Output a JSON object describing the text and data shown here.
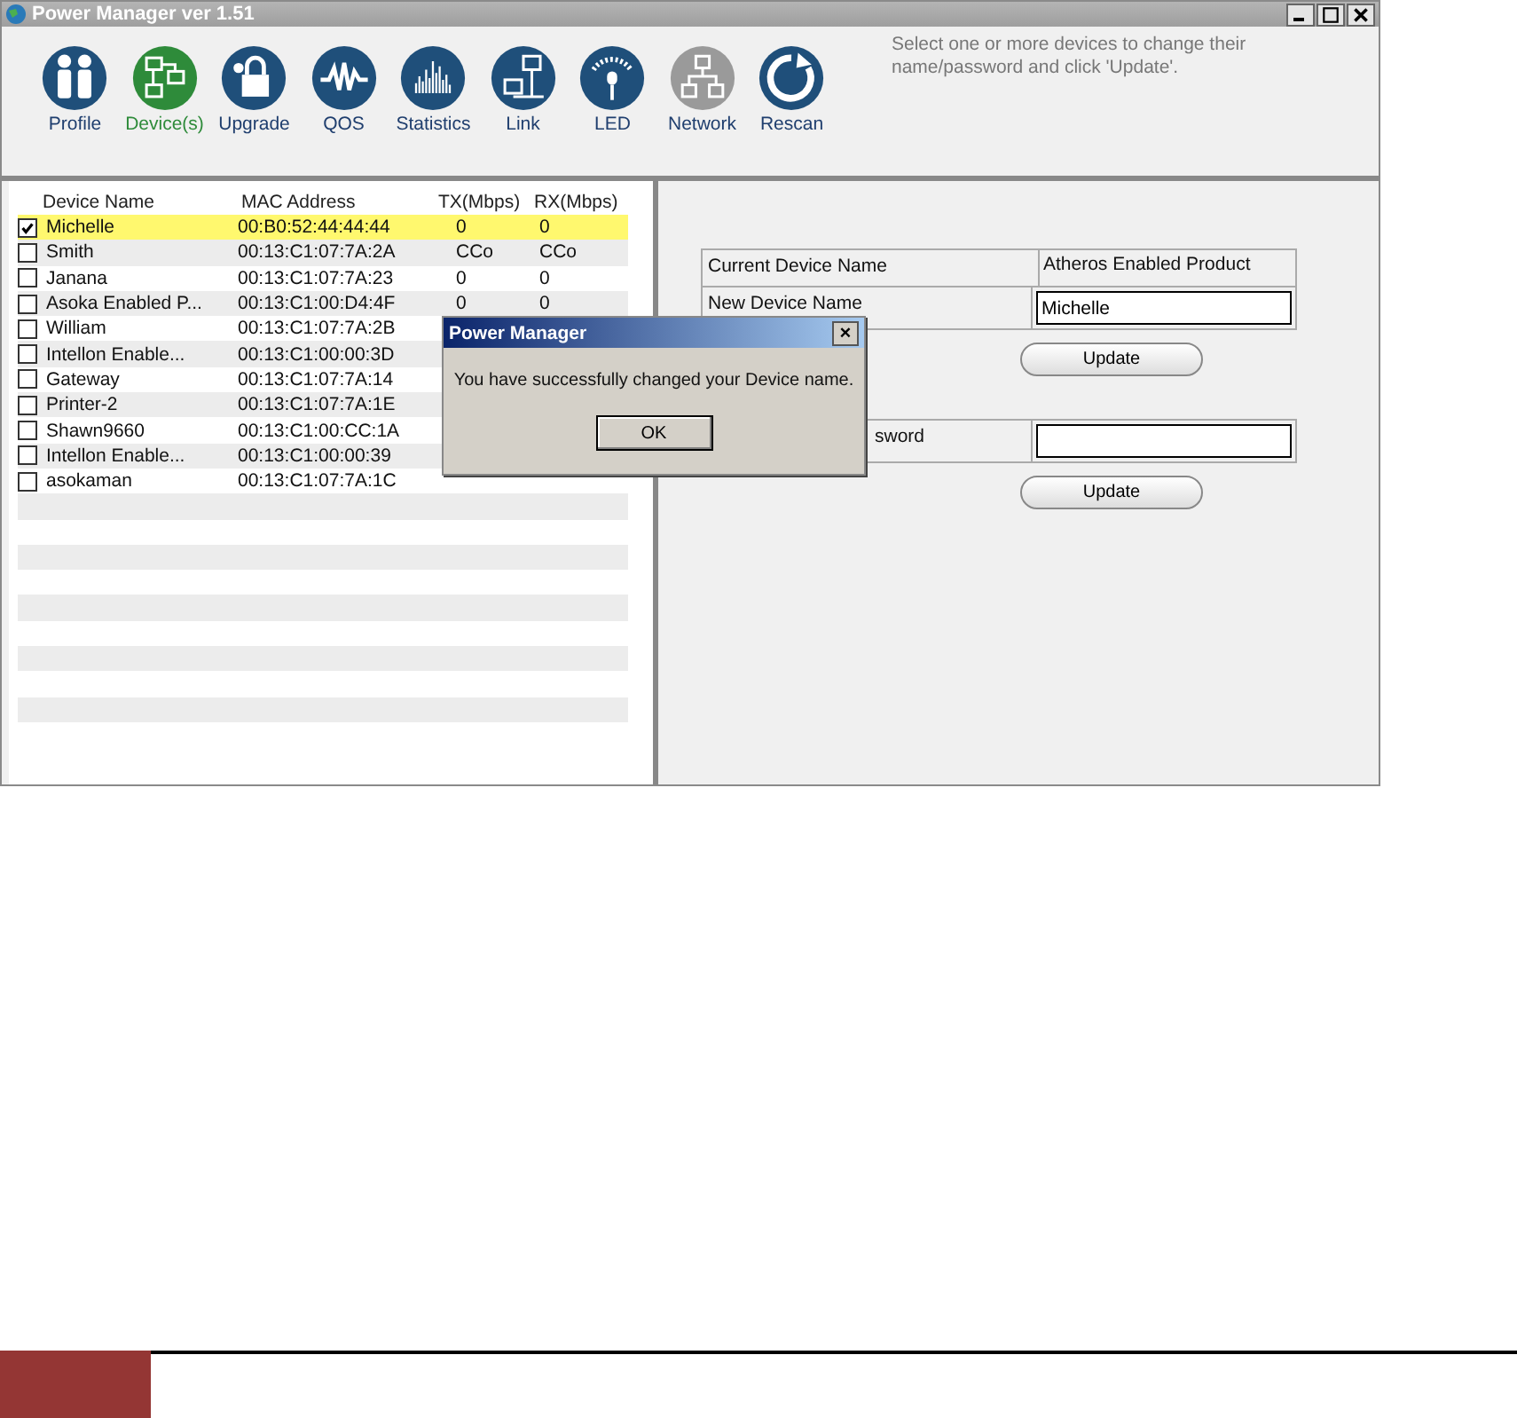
{
  "window": {
    "title": "Power Manager ver 1.51"
  },
  "toolbar": [
    {
      "label": "Profile",
      "kind": "profile",
      "selected": false,
      "disabled": false
    },
    {
      "label": "Device(s)",
      "kind": "devices",
      "selected": true,
      "disabled": false
    },
    {
      "label": "Upgrade",
      "kind": "upgrade",
      "selected": false,
      "disabled": false
    },
    {
      "label": "QOS",
      "kind": "qos",
      "selected": false,
      "disabled": false
    },
    {
      "label": "Statistics",
      "kind": "statistics",
      "selected": false,
      "disabled": false
    },
    {
      "label": "Link",
      "kind": "link",
      "selected": false,
      "disabled": false
    },
    {
      "label": "LED",
      "kind": "led",
      "selected": false,
      "disabled": false
    },
    {
      "label": "Network",
      "kind": "network",
      "selected": false,
      "disabled": true
    },
    {
      "label": "Rescan",
      "kind": "rescan",
      "selected": false,
      "disabled": false
    }
  ],
  "hint": "Select one or more devices to change their name/password and click 'Update'.",
  "table": {
    "columns": [
      "Device Name",
      "MAC Address",
      "TX(Mbps)",
      "RX(Mbps)"
    ],
    "rows": [
      {
        "name": "Michelle",
        "mac": "00:B0:52:44:44:44",
        "tx": "0",
        "rx": "0",
        "checked": true,
        "selected": true
      },
      {
        "name": "Smith",
        "mac": "00:13:C1:07:7A:2A",
        "tx": "CCo",
        "rx": "CCo",
        "checked": false,
        "selected": false
      },
      {
        "name": "Janana",
        "mac": "00:13:C1:07:7A:23",
        "tx": "0",
        "rx": "0",
        "checked": false,
        "selected": false
      },
      {
        "name": "Asoka Enabled P...",
        "mac": "00:13:C1:00:D4:4F",
        "tx": "0",
        "rx": "0",
        "checked": false,
        "selected": false
      },
      {
        "name": "William",
        "mac": "00:13:C1:07:7A:2B",
        "checked": false,
        "selected": false
      },
      {
        "name": "Intellon Enable...",
        "mac": "00:13:C1:00:00:3D",
        "checked": false,
        "selected": false
      },
      {
        "name": "Gateway",
        "mac": "00:13:C1:07:7A:14",
        "checked": false,
        "selected": false
      },
      {
        "name": "Printer-2",
        "mac": "00:13:C1:07:7A:1E",
        "checked": false,
        "selected": false
      },
      {
        "name": "Shawn9660",
        "mac": "00:13:C1:00:CC:1A",
        "checked": false,
        "selected": false
      },
      {
        "name": "Intellon Enable...",
        "mac": "00:13:C1:00:00:39",
        "checked": false,
        "selected": false
      },
      {
        "name": "asokaman",
        "mac": "00:13:C1:07:7A:1C",
        "checked": false,
        "selected": false
      }
    ]
  },
  "form": {
    "current_label": "Current Device Name",
    "current_value": "Atheros Enabled Product",
    "new_label": "New Device Name",
    "new_value": "Michelle",
    "update_button": "Update",
    "password_label": "sword",
    "password_update_button": "Update"
  },
  "dialog": {
    "title": "Power Manager",
    "close": "×",
    "message": "You have successfully changed your Device name.",
    "ok_button": "OK"
  }
}
